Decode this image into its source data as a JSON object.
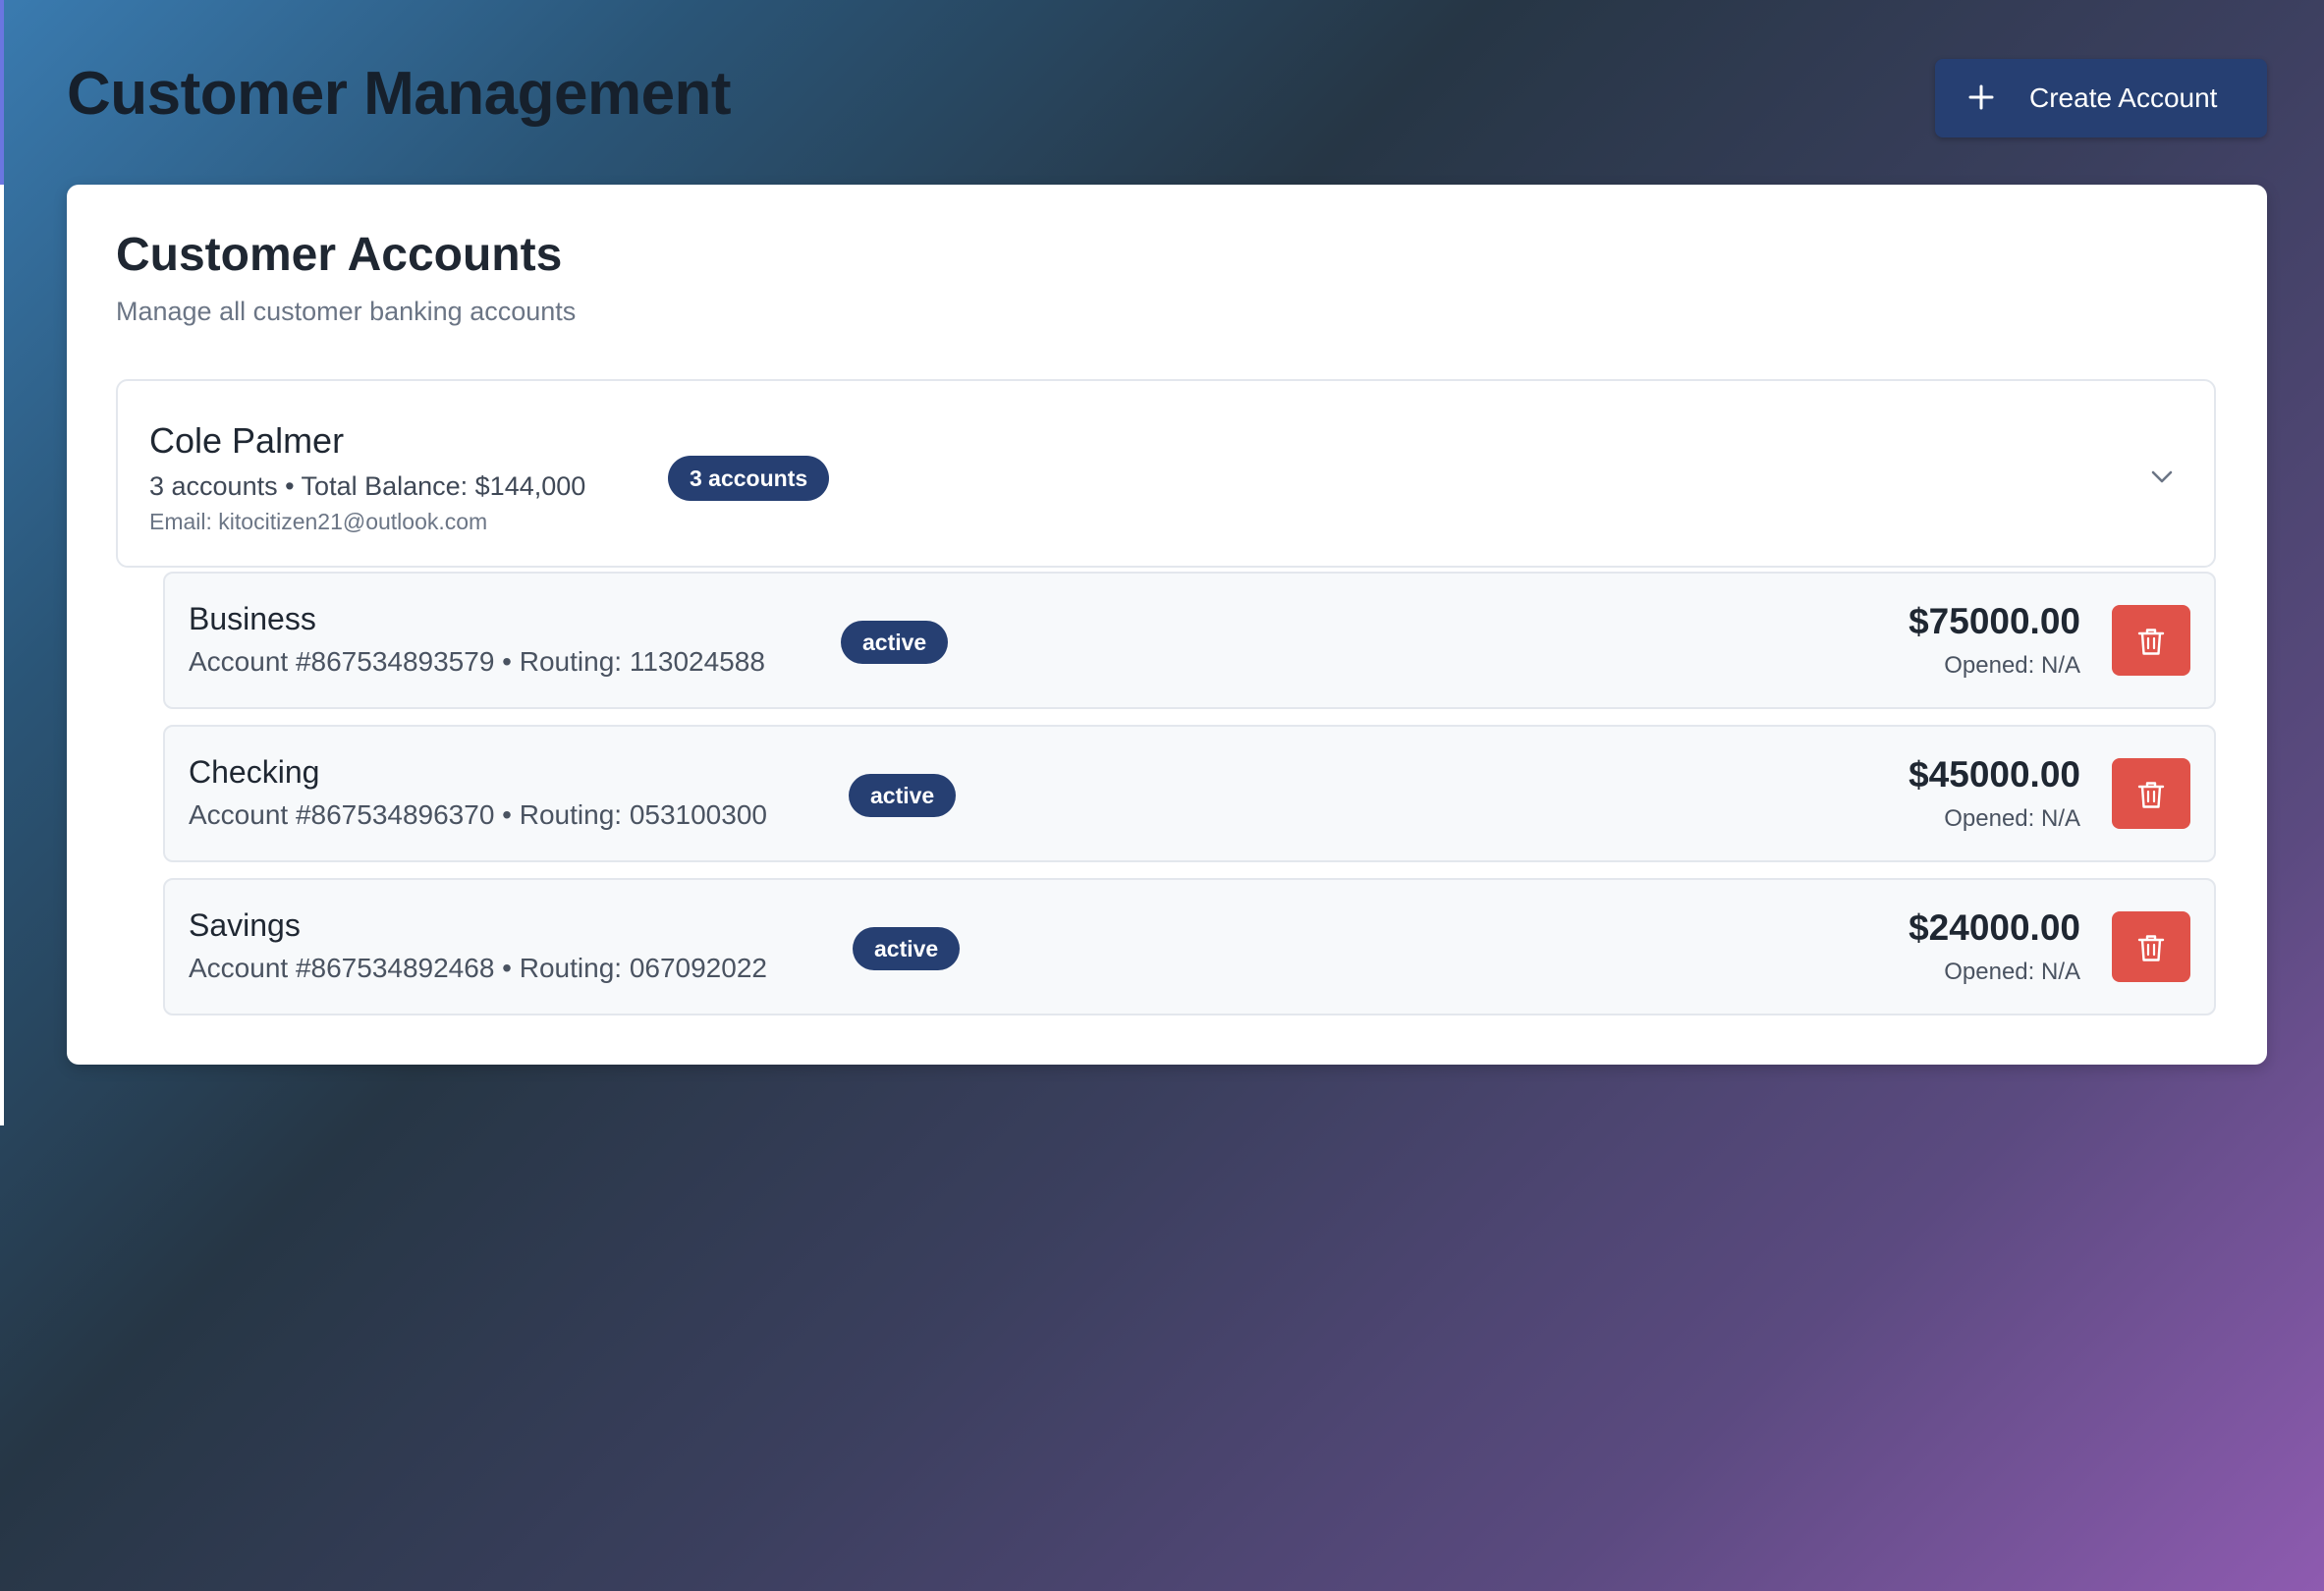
{
  "header": {
    "title": "Customer Management",
    "create_button_label": "Create Account"
  },
  "card": {
    "title": "Customer Accounts",
    "subtitle": "Manage all customer banking accounts"
  },
  "customer": {
    "name": "Cole Palmer",
    "summary": "3 accounts • Total Balance: $144,000",
    "badge": "3 accounts",
    "email": "Email: kitocitizen21@outlook.com",
    "expanded": true
  },
  "accounts": [
    {
      "type": "Business",
      "details": "Account #867534893579 • Routing: 113024588",
      "status": "active",
      "balance": "$75000.00",
      "opened": "Opened: N/A"
    },
    {
      "type": "Checking",
      "details": "Account #867534896370 • Routing: 053100300",
      "status": "active",
      "balance": "$45000.00",
      "opened": "Opened: N/A"
    },
    {
      "type": "Savings",
      "details": "Account #867534892468 • Routing: 067092022",
      "status": "active",
      "balance": "$24000.00",
      "opened": "Opened: N/A"
    }
  ],
  "icons": {
    "create": "plus-icon",
    "expand": "chevron-down-icon",
    "delete": "trash-icon"
  },
  "colors": {
    "primary": "#263f72",
    "danger": "#e05249",
    "card_background": "#ffffff",
    "account_background": "#f7f9fb"
  }
}
